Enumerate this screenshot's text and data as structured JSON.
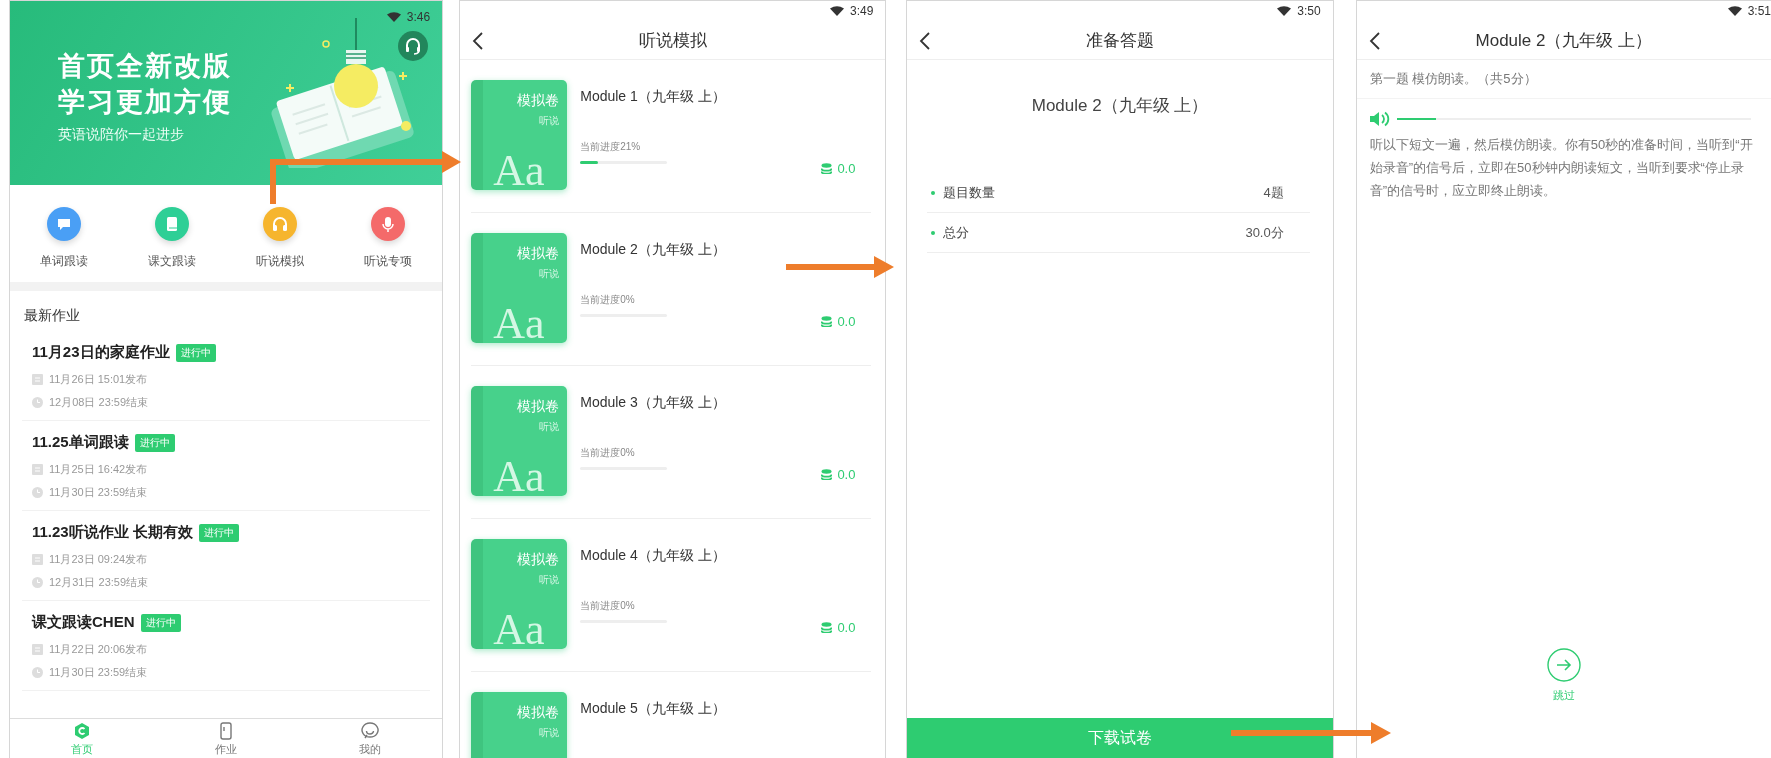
{
  "home_screen": {
    "status_time": "3:46",
    "banner": {
      "title_lines": [
        "首页全新改版",
        "学习更加方便"
      ],
      "subtitle": "英语说陪你一起进步"
    },
    "quick_actions": [
      {
        "label": "单词跟读",
        "color": "#4a9ff5"
      },
      {
        "label": "课文跟读",
        "color": "#2ecf96"
      },
      {
        "label": "听说模拟",
        "color": "#f6b52e"
      },
      {
        "label": "听说专项",
        "color": "#f46a6a"
      }
    ],
    "section_title": "最新作业",
    "assignments": [
      {
        "title": "11月23日的家庭作业",
        "badge": "进行中",
        "published": "11月26日 15:01发布",
        "deadline": "12月08日 23:59结束"
      },
      {
        "title": "11.25单词跟读",
        "badge": "进行中",
        "published": "11月25日 16:42发布",
        "deadline": "11月30日 23:59结束"
      },
      {
        "title": "11.23听说作业 长期有效",
        "badge": "进行中",
        "published": "11月23日 09:24发布",
        "deadline": "12月31日 23:59结束"
      },
      {
        "title": "课文跟读CHEN",
        "badge": "进行中",
        "published": "11月22日 20:06发布",
        "deadline": "11月30日 23:59结束"
      }
    ],
    "nav": [
      {
        "label": "首页",
        "selected": true
      },
      {
        "label": "作业",
        "selected": false
      },
      {
        "label": "我的",
        "selected": false
      }
    ]
  },
  "list_screen": {
    "status_time": "3:49",
    "title": "听说模拟",
    "modules": [
      {
        "title": "Module 1（九年级 上）",
        "cover_title": "模拟卷",
        "cover_subtitle": "听说",
        "cover_letters": "Aa",
        "progress_label": "当前进度21%",
        "level": 0.21,
        "score": "0.0"
      },
      {
        "title": "Module 2（九年级 上）",
        "cover_title": "模拟卷",
        "cover_subtitle": "听说",
        "cover_letters": "Aa",
        "progress_label": "当前进度0%",
        "level": 0,
        "score": "0.0"
      },
      {
        "title": "Module 3（九年级 上）",
        "cover_title": "模拟卷",
        "cover_subtitle": "听说",
        "cover_letters": "Aa",
        "progress_label": "当前进度0%",
        "level": 0,
        "score": "0.0"
      },
      {
        "title": "Module 4（九年级 上）",
        "cover_title": "模拟卷",
        "cover_subtitle": "听说",
        "cover_letters": "Aa",
        "progress_label": "当前进度0%",
        "level": 0,
        "score": "0.0"
      },
      {
        "title": "Module 5（九年级 上）",
        "cover_title": "模拟卷",
        "cover_subtitle": "听说"
      }
    ]
  },
  "prepare_screen": {
    "status_time": "3:50",
    "title": "准备答题",
    "module_title": "Module 2（九年级 上）",
    "stats": [
      {
        "label": "题目数量",
        "value": "4题"
      },
      {
        "label": "总分",
        "value": "30.0分"
      }
    ],
    "download_button": "下载试卷"
  },
  "question_screen": {
    "status_time": "3:51",
    "title": "Module 2（九年级 上）",
    "question_heading": "第一题 模仿朗读。（共5分）",
    "audio": {
      "level": 0.11
    },
    "instructions": "听以下短文一遍，然后模仿朗读。你有50秒的准备时间，当听到“开始录音”的信号后，立即在50秒钟内朗读短文，当听到要求“停止录音”的信号时，应立即终止朗读。",
    "skip_label": "跳过"
  }
}
